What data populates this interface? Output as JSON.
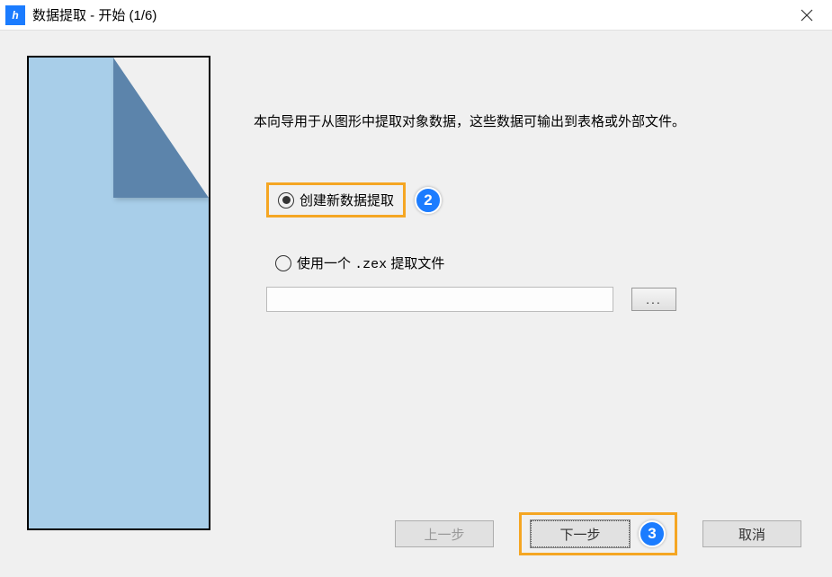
{
  "window": {
    "title": "数据提取 - 开始 (1/6)"
  },
  "description": "本向导用于从图形中提取对象数据，这些数据可输出到表格或外部文件。",
  "options": {
    "create_new_label": "创建新数据提取",
    "use_file_label_prefix": "使用一个 ",
    "use_file_ext": ".zex",
    "use_file_label_suffix": " 提取文件",
    "file_path": "",
    "browse_label": "..."
  },
  "buttons": {
    "prev": "上一步",
    "next": "下一步",
    "cancel": "取消"
  },
  "annotations": {
    "step2": "2",
    "step3": "3"
  }
}
